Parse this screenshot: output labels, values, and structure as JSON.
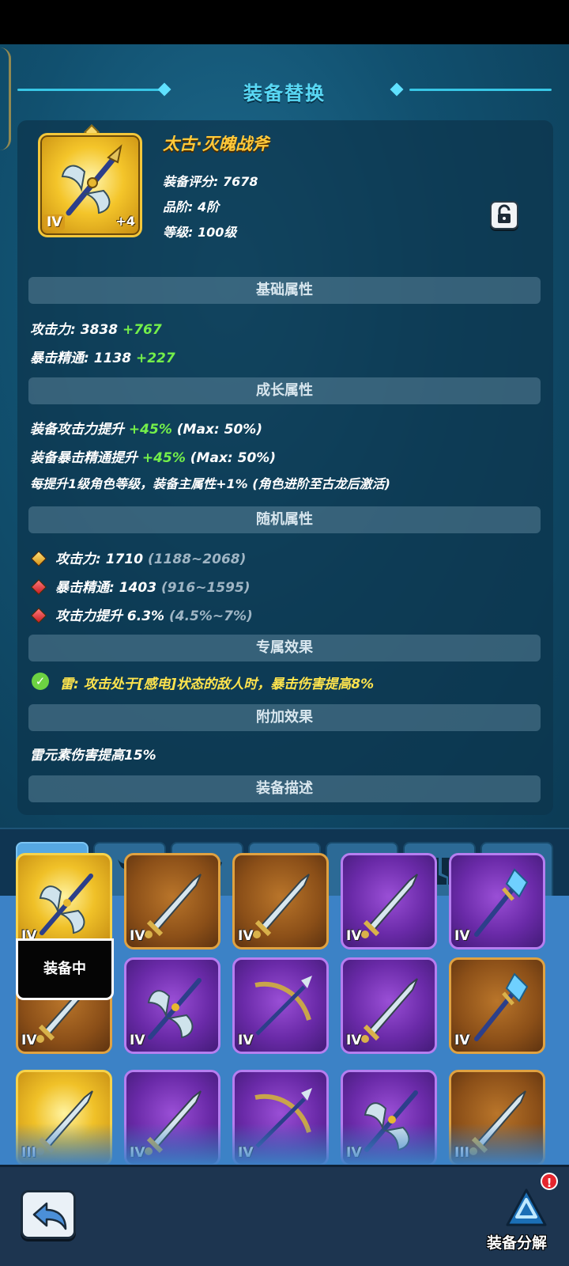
{
  "header": {
    "title": "装备替换"
  },
  "item": {
    "name": "太古·灭魄战斧",
    "grade_badge": "IV",
    "enhance": "+4",
    "score_label": "装备评分:",
    "score": "7678",
    "tier_label": "品阶:",
    "tier": "4阶",
    "level_label": "等级:",
    "level": "100级",
    "lock_icon": "lock-open-icon"
  },
  "sections": {
    "base": "基础属性",
    "growth": "成长属性",
    "random": "随机属性",
    "exclusive": "专属效果",
    "extra": "附加效果",
    "description": "装备描述"
  },
  "base_attrs": [
    {
      "label": "攻击力:",
      "value": "3838",
      "bonus": "+767"
    },
    {
      "label": "暴击精通:",
      "value": "1138",
      "bonus": "+227"
    }
  ],
  "growth_attrs": [
    {
      "label": "装备攻击力提升",
      "value": "+45%",
      "max": "(Max: 50%)"
    },
    {
      "label": "装备暴击精通提升",
      "value": "+45%",
      "max": "(Max: 50%)"
    },
    {
      "label": "每提升1级角色等级，装备主属性+1% (角色进阶至古龙后激活)",
      "value": "",
      "max": ""
    }
  ],
  "random_attrs": [
    {
      "text": "攻击力: 1710",
      "range": "(1188~2068)",
      "color": "gold"
    },
    {
      "text": "暴击精通: 1403",
      "range": "(916~1595)",
      "color": "red"
    },
    {
      "text": "攻击力提升 6.3%",
      "range": "(4.5%~7%)",
      "color": "red"
    }
  ],
  "exclusive_effect": "雷: 攻击处于[感电]状态的敌人时，暴击伤害提高8%",
  "extra_effect": "雷元素伤害提高15%",
  "tabs": [
    {
      "name": "weapon",
      "icon": "sword-icon",
      "active": true
    },
    {
      "name": "helmet",
      "icon": "helmet-icon",
      "active": false
    },
    {
      "name": "armor",
      "icon": "armor-icon",
      "active": false
    },
    {
      "name": "bracer",
      "icon": "bracer-icon",
      "active": false
    },
    {
      "name": "pants",
      "icon": "pants-icon",
      "active": false
    },
    {
      "name": "boots",
      "icon": "boots-icon",
      "active": false
    },
    {
      "name": "necklace",
      "icon": "necklace-icon",
      "active": false
    }
  ],
  "inventory": {
    "equipped_label": "装备中",
    "rows": [
      [
        {
          "rarity": "gold",
          "grade": "IV",
          "type": "axe"
        },
        {
          "rarity": "orange",
          "grade": "IV",
          "type": "sword"
        },
        {
          "rarity": "orange",
          "grade": "IV",
          "type": "sword"
        },
        {
          "rarity": "purple",
          "grade": "IV",
          "type": "sword"
        },
        {
          "rarity": "purple",
          "grade": "IV",
          "type": "staff"
        }
      ],
      [
        {
          "rarity": "orange",
          "grade": "IV",
          "type": "sword"
        },
        {
          "rarity": "purple",
          "grade": "IV",
          "type": "axe"
        },
        {
          "rarity": "purple",
          "grade": "IV",
          "type": "crossbow"
        },
        {
          "rarity": "purple",
          "grade": "IV",
          "type": "sword"
        },
        {
          "rarity": "orange",
          "grade": "IV",
          "type": "staff"
        }
      ],
      [
        {
          "rarity": "gold",
          "grade": "III",
          "type": "sword"
        },
        {
          "rarity": "purple",
          "grade": "IV",
          "type": "sword"
        },
        {
          "rarity": "purple",
          "grade": "IV",
          "type": "crossbow"
        },
        {
          "rarity": "purple",
          "grade": "IV",
          "type": "axe"
        },
        {
          "rarity": "orange",
          "grade": "III",
          "type": "sword"
        }
      ]
    ]
  },
  "bottom": {
    "back_icon": "back-arrow-icon",
    "recycle_icon": "recycle-icon",
    "recycle_badge": "!",
    "recycle_label": "装备分解"
  },
  "colors": {
    "accent": "#59d8f4",
    "name_gold": "#ffc93a",
    "bonus_green": "#74ef4a",
    "effect_yellow": "#ffe44d"
  }
}
